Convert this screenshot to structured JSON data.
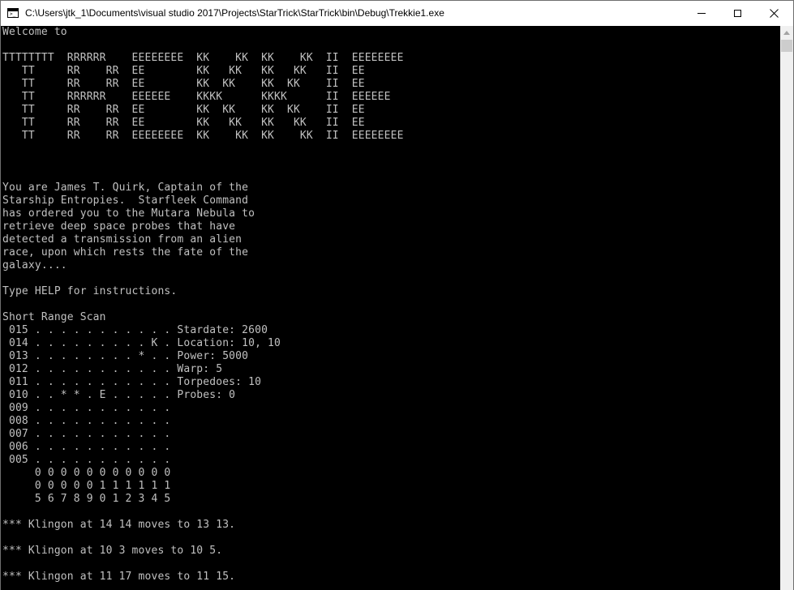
{
  "window": {
    "title": "C:\\Users\\jtk_1\\Documents\\visual studio 2017\\Projects\\StarTrick\\StarTrick\\bin\\Debug\\Trekkie1.exe",
    "icon": "console-window-icon",
    "controls": [
      "minimize-icon",
      "maximize-icon",
      "close-icon"
    ]
  },
  "console": {
    "lines": [
      "Welcome to",
      "",
      "TTTTTTTT  RRRRRR    EEEEEEEE  KK    KK  KK    KK  II  EEEEEEEE",
      "   TT     RR    RR  EE        KK   KK   KK   KK   II  EE",
      "   TT     RR    RR  EE        KK  KK    KK  KK    II  EE",
      "   TT     RRRRRR    EEEEEE    KKKK      KKKK      II  EEEEEE",
      "   TT     RR    RR  EE        KK  KK    KK  KK    II  EE",
      "   TT     RR    RR  EE        KK   KK   KK   KK   II  EE",
      "   TT     RR    RR  EEEEEEEE  KK    KK  KK    KK  II  EEEEEEEE",
      "",
      "",
      "",
      "You are James T. Quirk, Captain of the",
      "Starship Entropies.  Starfleek Command",
      "has ordered you to the Mutara Nebula to",
      "retrieve deep space probes that have",
      "detected a transmission from an alien",
      "race, upon which rests the fate of the",
      "galaxy....",
      "",
      "Type HELP for instructions.",
      "",
      "Short Range Scan",
      " 015 . . . . . . . . . . . Stardate: 2600",
      " 014 . . . . . . . . . K . Location: 10, 10",
      " 013 . . . . . . . . * . . Power: 5000",
      " 012 . . . . . . . . . . . Warp: 5",
      " 011 . . . . . . . . . . . Torpedoes: 10",
      " 010 . . * * . E . . . . . Probes: 0",
      " 009 . . . . . . . . . . .",
      " 008 . . . . . . . . . . .",
      " 007 . . . . . . . . . . .",
      " 006 . . . . . . . . . . .",
      " 005 . . . . . . . . . . .",
      "     0 0 0 0 0 0 0 0 0 0 0",
      "     0 0 0 0 0 1 1 1 1 1 1",
      "     5 6 7 8 9 0 1 2 3 4 5",
      "",
      "*** Klingon at 14 14 moves to 13 13.",
      "",
      "*** Klingon at 10 3 moves to 10 5.",
      "",
      "*** Klingon at 11 17 moves to 11 15."
    ]
  }
}
